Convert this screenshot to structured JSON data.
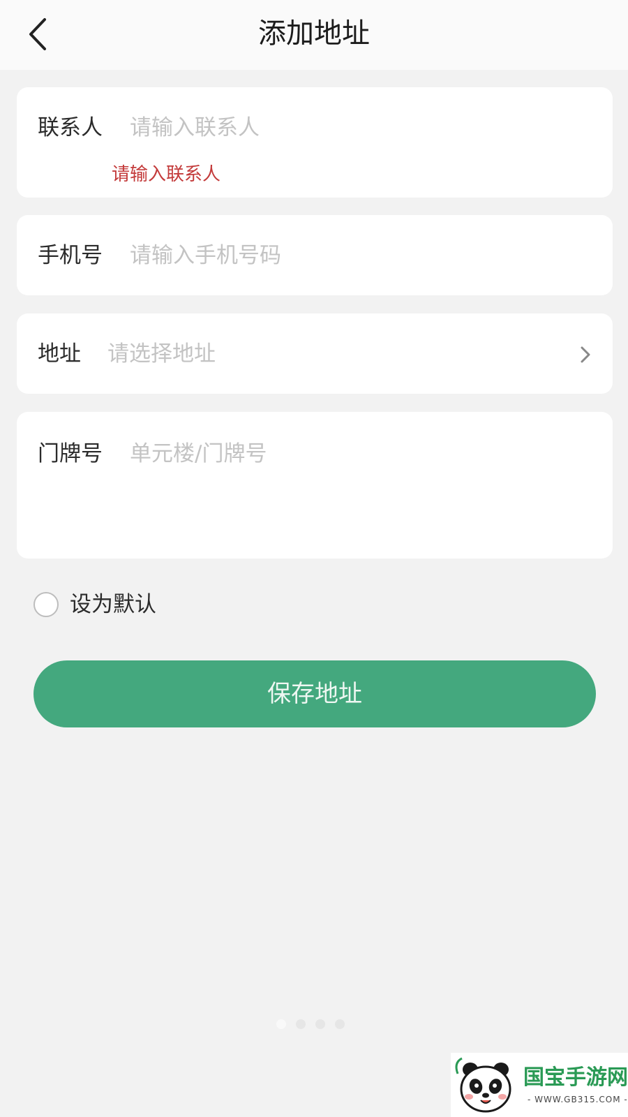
{
  "header": {
    "title": "添加地址",
    "back_icon": "chevron-left-icon"
  },
  "contact": {
    "label": "联系人",
    "placeholder": "请输入联系人",
    "value": "",
    "error": "请输入联系人"
  },
  "phone": {
    "label": "手机号",
    "placeholder": "请输入手机号码",
    "value": ""
  },
  "address": {
    "label": "地址",
    "placeholder": "请选择地址",
    "value": "",
    "icon": "chevron-right-icon"
  },
  "house_number": {
    "label": "门牌号",
    "placeholder": "单元楼/门牌号",
    "value": ""
  },
  "default_option": {
    "label": "设为默认",
    "checked": false
  },
  "save_button": {
    "label": "保存地址"
  },
  "pager": {
    "count": 4,
    "active_index": 0
  },
  "watermark": {
    "brand": "国宝手游网",
    "url": "- WWW.GB315.COM -"
  },
  "colors": {
    "primary": "#44a87e",
    "error": "#c33a3a",
    "background": "#f2f2f2",
    "placeholder": "#c3c3c3"
  }
}
